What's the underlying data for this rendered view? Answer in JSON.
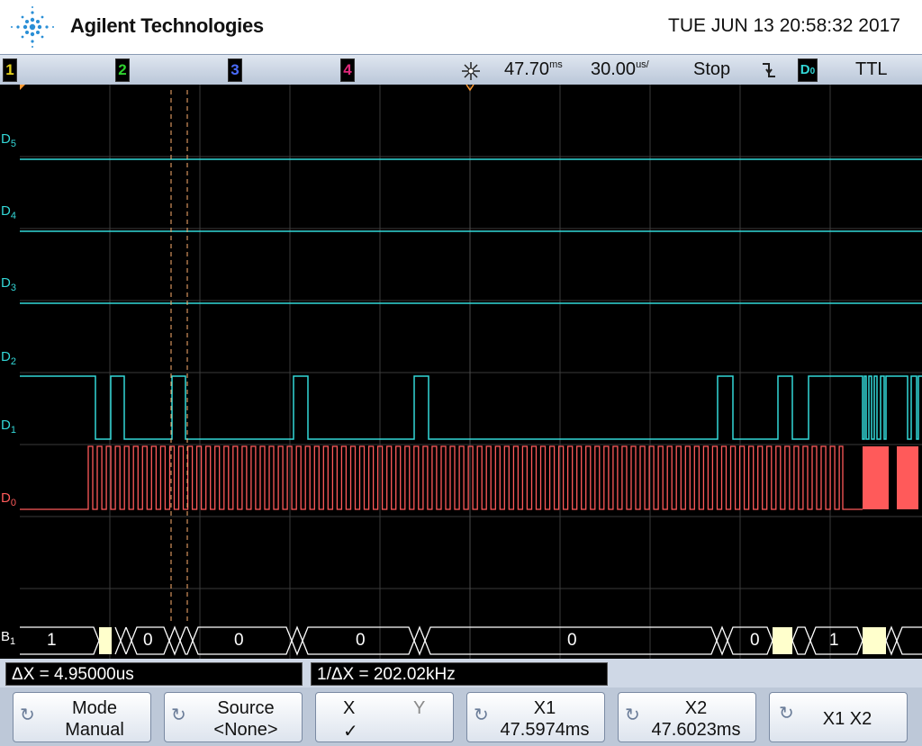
{
  "header": {
    "brand": "Agilent Technologies",
    "datetime": "TUE JUN 13 20:58:32 2017"
  },
  "status_bar": {
    "channels": [
      {
        "label": "1",
        "color": "#e6d21a"
      },
      {
        "label": "2",
        "color": "#2fd22f"
      },
      {
        "label": "3",
        "color": "#4a6cff"
      },
      {
        "label": "4",
        "color": "#e0287a"
      }
    ],
    "trigger_icon": "trigger-position-icon",
    "time_offset": "47.70",
    "time_offset_unit": "ms",
    "time_scale": "30.00",
    "time_scale_unit": "us/",
    "run_state": "Stop",
    "trigger_slope_icon": "falling-edge-icon",
    "trigger_source": "D0",
    "threshold": "TTL"
  },
  "channel_labels": [
    {
      "name": "D",
      "sub": "5"
    },
    {
      "name": "D",
      "sub": "4"
    },
    {
      "name": "D",
      "sub": "3"
    },
    {
      "name": "D",
      "sub": "2"
    },
    {
      "name": "D",
      "sub": "1"
    },
    {
      "name": "D",
      "sub": "0"
    },
    {
      "name": "B",
      "sub": "1"
    }
  ],
  "bus": {
    "values": [
      "1",
      "0",
      "0",
      "0",
      "0",
      "0",
      "1"
    ]
  },
  "measurements": {
    "delta_x": "ΔX = 4.95000us",
    "inv_delta_x": "1/ΔX = 202.02kHz"
  },
  "softkeys": {
    "mode_label": "Mode",
    "mode_value": "Manual",
    "source_label": "Source",
    "source_value": "<None>",
    "x_label": "X",
    "y_label": "Y",
    "x_check": "✓",
    "x1_label": "X1",
    "x1_value": "47.5974ms",
    "x2_label": "X2",
    "x2_value": "47.6023ms",
    "x1x2_label": "X1 X2"
  },
  "colors": {
    "digital": "#33d7d7",
    "d0": "#ff5a5a",
    "cursor": "#ffb070",
    "bus_fill": "#ffffcc"
  }
}
